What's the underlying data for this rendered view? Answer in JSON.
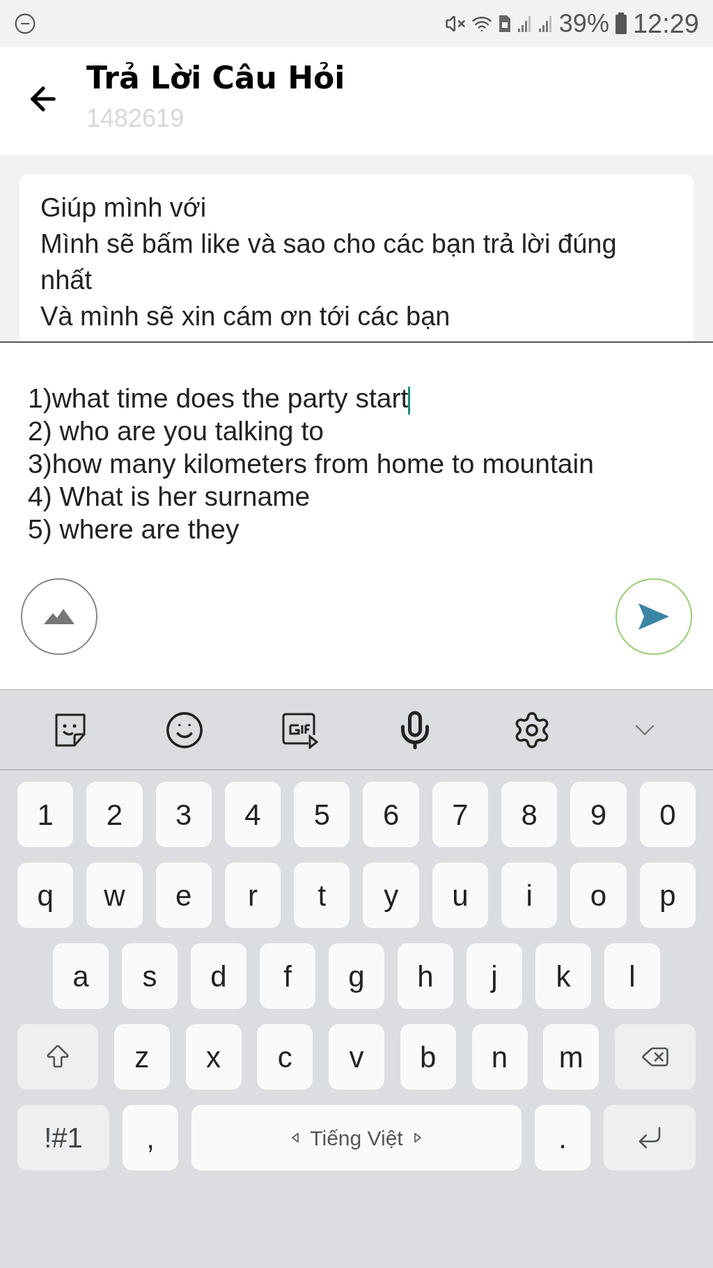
{
  "status_bar": {
    "battery": "39%",
    "time": "12:29"
  },
  "header": {
    "title": "Trả Lời Câu Hỏi",
    "subtitle": "1482619"
  },
  "question": {
    "lines": [
      "Giúp mình với",
      "Mình sẽ bấm like và sao cho các bạn trả lời đúng nhất",
      "Và mình sẽ xin cám ơn tới các bạn"
    ]
  },
  "answer": {
    "value": "1)what time does the party start\n2) who are you talking to\n3)how many kilometers from home to mountain\n4) What is her surname\n5) where are they"
  },
  "keyboard": {
    "rows": [
      [
        {
          "kind": "key",
          "label": "1"
        },
        {
          "kind": "key",
          "label": "2"
        },
        {
          "kind": "key",
          "label": "3"
        },
        {
          "kind": "key",
          "label": "4"
        },
        {
          "kind": "key",
          "label": "5"
        },
        {
          "kind": "key",
          "label": "6"
        },
        {
          "kind": "key",
          "label": "7"
        },
        {
          "kind": "key",
          "label": "8"
        },
        {
          "kind": "key",
          "label": "9"
        },
        {
          "kind": "key",
          "label": "0"
        }
      ],
      [
        {
          "kind": "key",
          "label": "q"
        },
        {
          "kind": "key",
          "label": "w"
        },
        {
          "kind": "key",
          "label": "e"
        },
        {
          "kind": "key",
          "label": "r"
        },
        {
          "kind": "key",
          "label": "t"
        },
        {
          "kind": "key",
          "label": "y"
        },
        {
          "kind": "key",
          "label": "u"
        },
        {
          "kind": "key",
          "label": "i"
        },
        {
          "kind": "key",
          "label": "o"
        },
        {
          "kind": "key",
          "label": "p"
        }
      ],
      [
        {
          "kind": "key",
          "label": "a"
        },
        {
          "kind": "key",
          "label": "s"
        },
        {
          "kind": "key",
          "label": "d"
        },
        {
          "kind": "key",
          "label": "f"
        },
        {
          "kind": "key",
          "label": "g"
        },
        {
          "kind": "key",
          "label": "h"
        },
        {
          "kind": "key",
          "label": "j"
        },
        {
          "kind": "key",
          "label": "k"
        },
        {
          "kind": "key",
          "label": "l"
        }
      ],
      [
        {
          "kind": "shift"
        },
        {
          "kind": "key",
          "label": "z"
        },
        {
          "kind": "key",
          "label": "x"
        },
        {
          "kind": "key",
          "label": "c"
        },
        {
          "kind": "key",
          "label": "v"
        },
        {
          "kind": "key",
          "label": "b"
        },
        {
          "kind": "key",
          "label": "n"
        },
        {
          "kind": "key",
          "label": "m"
        },
        {
          "kind": "backspace"
        }
      ],
      [
        {
          "kind": "symbols",
          "label": "!#1"
        },
        {
          "kind": "key",
          "label": ","
        }
      ]
    ],
    "space_key": {
      "label": "Tiếng Việt"
    },
    "right_keys": [
      {
        "kind": "key",
        "label": "."
      },
      {
        "kind": "enter"
      }
    ]
  }
}
